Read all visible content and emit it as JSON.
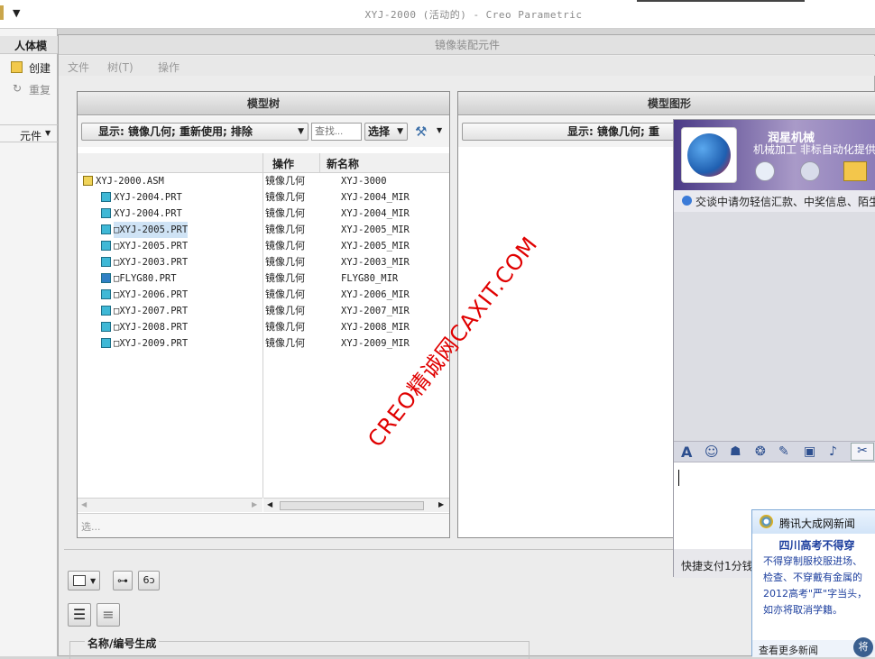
{
  "app": {
    "title": "XYJ-2000 (活动的) - Creo Parametric"
  },
  "left_panel": {
    "tab_label": "人体模",
    "create_label": "创建",
    "repeat_label": "重复",
    "component_label": "元件"
  },
  "dialog": {
    "title": "镜像装配元件",
    "menus": [
      "文件",
      "树(T)",
      "操作"
    ],
    "model_tree": {
      "header": "模型树",
      "display_combo": "显示: 镜像几何; 重新使用; 排除",
      "search_placeholder": "查找...",
      "select_label": "选择",
      "columns": {
        "operation": "操作",
        "new_name": "新名称"
      },
      "rows": [
        {
          "name": "XYJ-2000.ASM",
          "op": "镜像几何",
          "new_name": "XYJ-3000",
          "type": "asm"
        },
        {
          "name": "XYJ-2004.PRT",
          "op": "镜像几何",
          "new_name": "XYJ-2004_MIR",
          "type": "prt"
        },
        {
          "name": "XYJ-2004.PRT",
          "op": "镜像几何",
          "new_name": "XYJ-2004_MIR",
          "type": "prt"
        },
        {
          "name": "□XYJ-2005.PRT",
          "op": "镜像几何",
          "new_name": "XYJ-2005_MIR",
          "type": "prt",
          "selected": true
        },
        {
          "name": "□XYJ-2005.PRT",
          "op": "镜像几何",
          "new_name": "XYJ-2005_MIR",
          "type": "prt"
        },
        {
          "name": "□XYJ-2003.PRT",
          "op": "镜像几何",
          "new_name": "XYJ-2003_MIR",
          "type": "prt"
        },
        {
          "name": "□FLYG80.PRT",
          "op": "镜像几何",
          "new_name": "FLYG80_MIR",
          "type": "prt"
        },
        {
          "name": "□XYJ-2006.PRT",
          "op": "镜像几何",
          "new_name": "XYJ-2006_MIR",
          "type": "prt"
        },
        {
          "name": "□XYJ-2007.PRT",
          "op": "镜像几何",
          "new_name": "XYJ-2007_MIR",
          "type": "prt"
        },
        {
          "name": "□XYJ-2008.PRT",
          "op": "镜像几何",
          "new_name": "XYJ-2008_MIR",
          "type": "prt"
        },
        {
          "name": "□XYJ-2009.PRT",
          "op": "镜像几何",
          "new_name": "XYJ-2009_MIR",
          "type": "prt"
        }
      ],
      "status": "选..."
    },
    "model_graphics": {
      "header": "模型图形",
      "display_combo": "显示: 镜像几何; 重"
    },
    "naming_section": "名称/编号生成"
  },
  "chat": {
    "group_name": "润星机械",
    "group_desc": "机械加工 非标自动化提供",
    "notice": "交谈中请勿轻信汇款、中奖信息、陌生",
    "footer": "快捷支付1分钱"
  },
  "news": {
    "header": "腾讯大成网新闻",
    "headline": "四川高考不得穿",
    "body": "不得穿制服校服进场、检查、不穿戴有金属的2012高考\"严\"字当头，如亦将取消学籍。",
    "more": "查看更多新闻"
  },
  "watermark": "CREO精诚网CAXIT.COM",
  "colors": {
    "accent_red": "#e00000",
    "chat_purple": "#5a4696",
    "part_icon": "#3fb8d6"
  }
}
